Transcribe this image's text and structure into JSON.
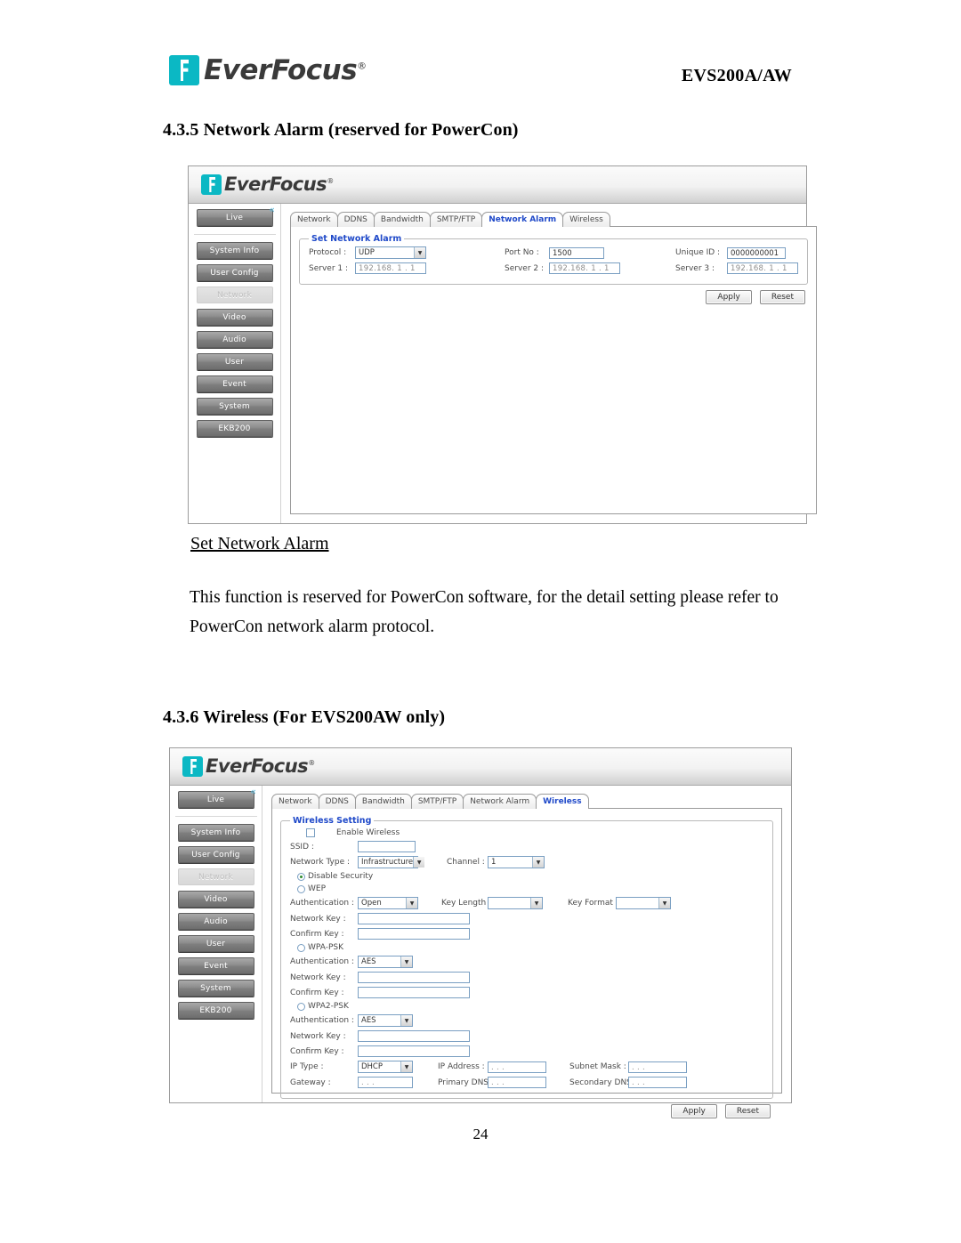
{
  "header": {
    "logo_text": "EverFocus",
    "logo_registered": "®",
    "model": "EVS200A/AW"
  },
  "sections": {
    "heading_435": "4.3.5 Network Alarm (reserved for PowerCon)",
    "subheading": "Set Network Alarm",
    "paragraph": "This function is reserved for PowerCon software, for the detail setting please refer to PowerCon network alarm protocol.",
    "heading_436": "4.3.6 Wireless (For EVS200AW only)"
  },
  "page_number": "24",
  "app": {
    "banner_logo": "EverFocus",
    "banner_reg": "®",
    "collapse_icon": "«",
    "sidebar": [
      {
        "label": "Live",
        "active": false
      },
      {
        "label": "System Info",
        "active": false
      },
      {
        "label": "User Config",
        "active": false
      },
      {
        "label": "Network",
        "active": true
      },
      {
        "label": "Video",
        "active": false
      },
      {
        "label": "Audio",
        "active": false
      },
      {
        "label": "User",
        "active": false
      },
      {
        "label": "Event",
        "active": false
      },
      {
        "label": "System",
        "active": false
      },
      {
        "label": "EKB200",
        "active": false
      }
    ],
    "tabs": [
      "Network",
      "DDNS",
      "Bandwidth",
      "SMTP/FTP",
      "Network Alarm",
      "Wireless"
    ],
    "buttons": {
      "apply": "Apply",
      "reset": "Reset"
    },
    "dropdown_arrow": "▼"
  },
  "network_alarm": {
    "active_tab": "Network Alarm",
    "group_legend": "Set Network Alarm",
    "labels": {
      "protocol": "Protocol :",
      "port_no": "Port No :",
      "unique_id": "Unique ID :",
      "server1": "Server 1 :",
      "server2": "Server 2 :",
      "server3": "Server 3 :"
    },
    "values": {
      "protocol": "UDP",
      "port_no": "1500",
      "unique_id": "0000000001",
      "server1": "192.168. 1 . 1",
      "server2": "192.168. 1 . 1",
      "server3": "192.168. 1 . 1"
    }
  },
  "wireless": {
    "active_tab": "Wireless",
    "group_legend": "Wireless Setting",
    "labels": {
      "enable_wireless": "Enable Wireless",
      "ssid": "SSID :",
      "network_type": "Network Type :",
      "channel": "Channel :",
      "disable_security": "Disable Security",
      "wep": "WEP",
      "authentication": "Authentication :",
      "key_length": "Key Length :",
      "key_format": "Key Format :",
      "network_key": "Network Key :",
      "confirm_key": "Confirm Key :",
      "wpa_psk": "WPA-PSK",
      "wpa2_psk": "WPA2-PSK",
      "ip_type": "IP Type :",
      "ip_address": "IP Address :",
      "subnet_mask": "Subnet Mask :",
      "gateway": "Gateway :",
      "primary_dns": "Primary DNS :",
      "secondary_dns": "Secondary DNS :"
    },
    "values": {
      "ssid": "",
      "network_type": "Infrastructure",
      "channel": "1",
      "wep_authentication": "Open",
      "key_length": "",
      "key_format": "",
      "wep_network_key": "",
      "wep_confirm_key": "",
      "wpa_authentication": "AES",
      "wpa_network_key": "",
      "wpa_confirm_key": "",
      "wpa2_authentication": "AES",
      "wpa2_network_key": "",
      "wpa2_confirm_key": "",
      "ip_type": "DHCP",
      "ip_address": ".      .      .",
      "subnet_mask": ".      .      .",
      "gateway": ".      .      .",
      "primary_dns": ".      .      .",
      "secondary_dns": ".      .      ."
    },
    "security_selected": "disable"
  }
}
